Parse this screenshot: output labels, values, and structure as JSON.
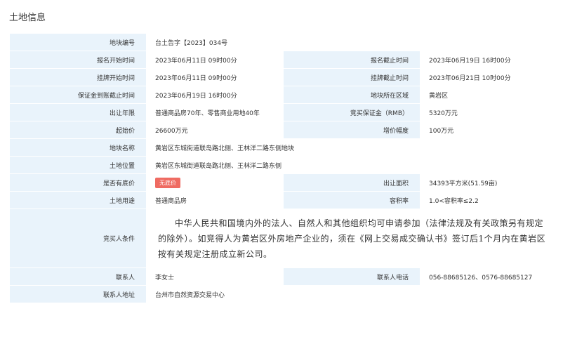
{
  "section_title": "土地信息",
  "rows": {
    "plot_no": {
      "label": "地块编号",
      "value": "台土告字【2023】034号"
    },
    "reg_start": {
      "label": "报名开始时间",
      "value": "2023年06月11日 09时00分"
    },
    "reg_end": {
      "label": "报名截止时间",
      "value": "2023年06月19日 16时00分"
    },
    "list_start": {
      "label": "挂牌开始时间",
      "value": "2023年06月11日 09时00分"
    },
    "list_end": {
      "label": "挂牌截止时间",
      "value": "2023年06月21日 10时00分"
    },
    "deposit_deadline": {
      "label": "保证金到账截止时间",
      "value": "2023年06月19日 16时00分"
    },
    "district": {
      "label": "地块所在区域",
      "value": "黄岩区"
    },
    "term": {
      "label": "出让年限",
      "value": "普通商品房70年、零售商业用地40年"
    },
    "deposit": {
      "label": "竞买保证金（RMB）",
      "value": "5320万元"
    },
    "start_price": {
      "label": "起始价",
      "value": "26600万元"
    },
    "increment": {
      "label": "增价幅度",
      "value": "100万元"
    },
    "plot_name": {
      "label": "地块名称",
      "value": "黄岩区东城街道联岛路北侧、王林洋二路东侧地块"
    },
    "location": {
      "label": "土地位置",
      "value": "黄岩区东城街道联岛路北侧、王林洋二路东侧"
    },
    "reserve": {
      "label": "是否有底价",
      "value": "无底价"
    },
    "area": {
      "label": "出让面积",
      "value": "34393平方米(51.59亩)"
    },
    "use": {
      "label": "土地用途",
      "value": "普通商品房"
    },
    "far": {
      "label": "容积率",
      "value": "1.0<容积率≤2.2"
    },
    "conditions": {
      "label": "竞买人条件",
      "value": "中华人民共和国境内外的法人、自然人和其他组织均可申请参加（法律法规及有关政策另有规定的除外）。如竞得人为黄岩区外房地产企业的，须在《网上交易成交确认书》签订后1个月内在黄岩区按有关规定注册成立新公司。"
    },
    "contact": {
      "label": "联系人",
      "value": "李女士"
    },
    "phone": {
      "label": "联系人电话",
      "value": "056-88685126、0576-88685127"
    },
    "address": {
      "label": "联系人地址",
      "value": "台州市自然资源交易中心"
    }
  },
  "colors": {
    "label_bg": "#e9f3fb",
    "badge_bg": "#ef6b62"
  }
}
